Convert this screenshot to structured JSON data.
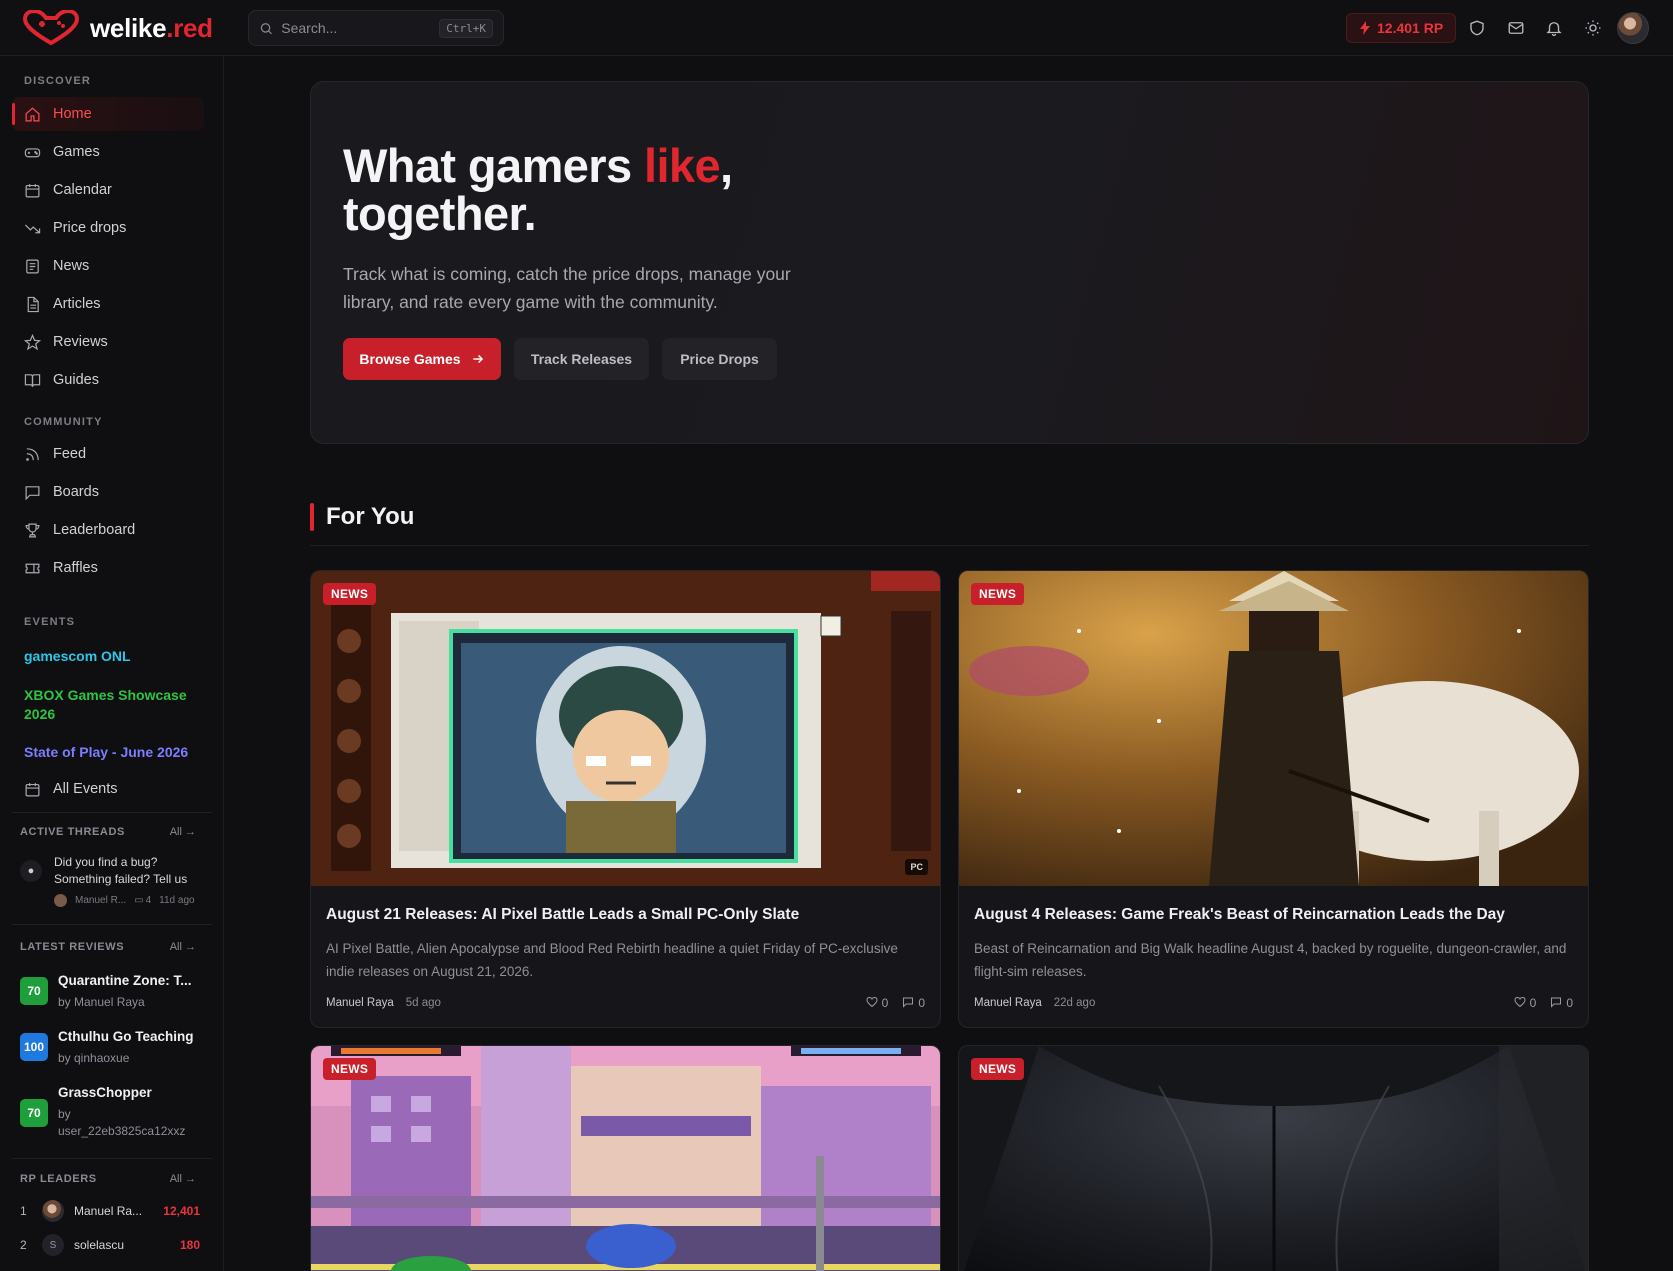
{
  "brand": {
    "name_white": "welike",
    "name_red": ".red",
    "logo_icon": "heart-gamepad-icon"
  },
  "search": {
    "placeholder": "Search...",
    "shortcut": "Ctrl+K"
  },
  "header": {
    "rp": "12.401 RP",
    "icons": [
      "shield-icon",
      "mail-icon",
      "bell-icon",
      "sun-icon"
    ]
  },
  "colors": {
    "accent": "#e0262e",
    "bg": "#0f0f12",
    "event_cyan": "#2cc6e8",
    "event_green": "#2ec43f",
    "event_blue": "#7d7dff",
    "score_green": "#1f9e3c",
    "score_blue": "#1e7ae0"
  },
  "sidebar": {
    "discover_title": "DISCOVER",
    "discover": [
      {
        "label": "Home",
        "icon": "home-icon"
      },
      {
        "label": "Games",
        "icon": "gamepad-icon"
      },
      {
        "label": "Calendar",
        "icon": "calendar-icon"
      },
      {
        "label": "Price drops",
        "icon": "trending-down-icon"
      },
      {
        "label": "News",
        "icon": "newspaper-icon"
      },
      {
        "label": "Articles",
        "icon": "document-icon"
      },
      {
        "label": "Reviews",
        "icon": "star-icon"
      },
      {
        "label": "Guides",
        "icon": "book-icon"
      }
    ],
    "community_title": "COMMUNITY",
    "community": [
      {
        "label": "Feed",
        "icon": "rss-icon"
      },
      {
        "label": "Boards",
        "icon": "message-square-icon"
      },
      {
        "label": "Leaderboard",
        "icon": "trophy-icon"
      },
      {
        "label": "Raffles",
        "icon": "ticket-icon"
      }
    ],
    "events_title": "EVENTS",
    "events": [
      {
        "label": "gamescom ONL"
      },
      {
        "label": "XBOX Games Showcase 2026"
      },
      {
        "label": "State of Play - June 2026"
      }
    ],
    "all_events": "All Events",
    "threads_title": "ACTIVE THREADS",
    "threads_all": "All →",
    "thread": {
      "title": "Did you find a bug? Something failed? Tell us",
      "author": "Manuel R...",
      "comments": "4",
      "age": "11d ago"
    },
    "reviews_title": "LATEST REVIEWS",
    "reviews_all": "All →",
    "reviews": [
      {
        "score": "70",
        "title": "Quarantine Zone: T...",
        "by": "by Manuel Raya"
      },
      {
        "score": "100",
        "title": "Cthulhu Go Teaching",
        "by": "by qinhaoxue"
      },
      {
        "score": "70",
        "title": "GrassChopper",
        "by": "by user_22eb3825ca12xxz"
      }
    ],
    "leaders_title": "RP LEADERS",
    "leaders_all": "All →",
    "leaders": [
      {
        "rank": "1",
        "name": "Manuel Ra...",
        "rp": "12,401",
        "initial": ""
      },
      {
        "rank": "2",
        "name": "solelascu",
        "rp": "180",
        "initial": "S"
      }
    ]
  },
  "hero": {
    "title_a": "What gamers ",
    "title_accent": "like",
    "title_b": ",",
    "title_c": "together.",
    "subtitle": "Track what is coming, catch the price drops, manage your library, and rate every game with the community.",
    "btn_primary": "Browse Games",
    "btn_track": "Track Releases",
    "btn_price": "Price Drops"
  },
  "for_you": {
    "title": "For You",
    "cards": [
      {
        "badge": "NEWS",
        "platform": "PC",
        "title": "August 21 Releases: AI Pixel Battle Leads a Small PC-Only Slate",
        "desc": "AI Pixel Battle, Alien Apocalypse and Blood Red Rebirth headline a quiet Friday of PC-exclusive indie releases on August 21, 2026.",
        "author": "Manuel Raya",
        "age": "5d ago",
        "likes": "0",
        "comments": "0"
      },
      {
        "badge": "NEWS",
        "title": "August 4 Releases: Game Freak's Beast of Reincarnation Leads the Day",
        "desc": "Beast of Reincarnation and Big Walk headline August 4, backed by roguelite, dungeon-crawler, and flight-sim releases.",
        "author": "Manuel Raya",
        "age": "22d ago",
        "likes": "0",
        "comments": "0"
      },
      {
        "badge": "NEWS"
      },
      {
        "badge": "NEWS"
      }
    ]
  }
}
